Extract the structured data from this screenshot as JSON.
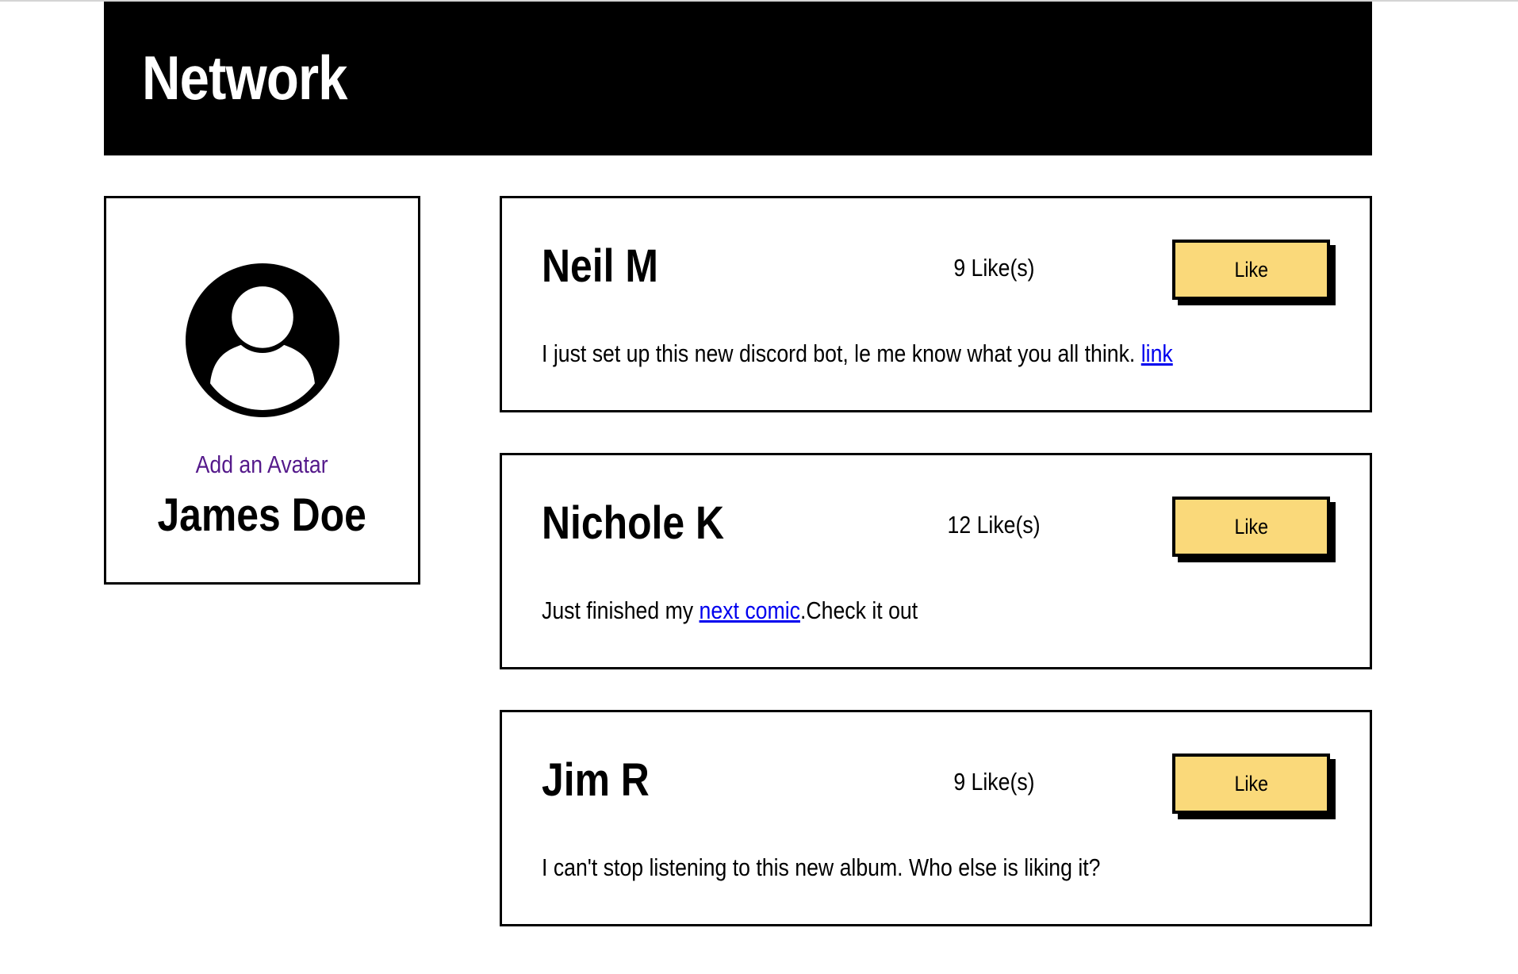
{
  "header": {
    "title": "Network"
  },
  "profile": {
    "avatar_icon": "user-avatar-icon",
    "add_avatar_label": "Add an Avatar",
    "name": "James Doe"
  },
  "posts": [
    {
      "author": "Neil M",
      "likes": "9 Like(s)",
      "like_label": "Like",
      "text_before": "I just set up this new discord bot, le me know what you all think. ",
      "link_text": "link",
      "text_after": ""
    },
    {
      "author": "Nichole K",
      "likes": "12 Like(s)",
      "like_label": "Like",
      "text_before": "Just finished my ",
      "link_text": "next comic",
      "text_after": ".Check it out"
    },
    {
      "author": "Jim R",
      "likes": "9 Like(s)",
      "like_label": "Like",
      "text_before": "I can't stop listening to this new album. Who else is liking it?",
      "link_text": "",
      "text_after": ""
    }
  ],
  "colors": {
    "header_bg": "#000000",
    "button_bg": "#fad97a",
    "link": "#0000ee",
    "visited_link": "#551a8b"
  }
}
